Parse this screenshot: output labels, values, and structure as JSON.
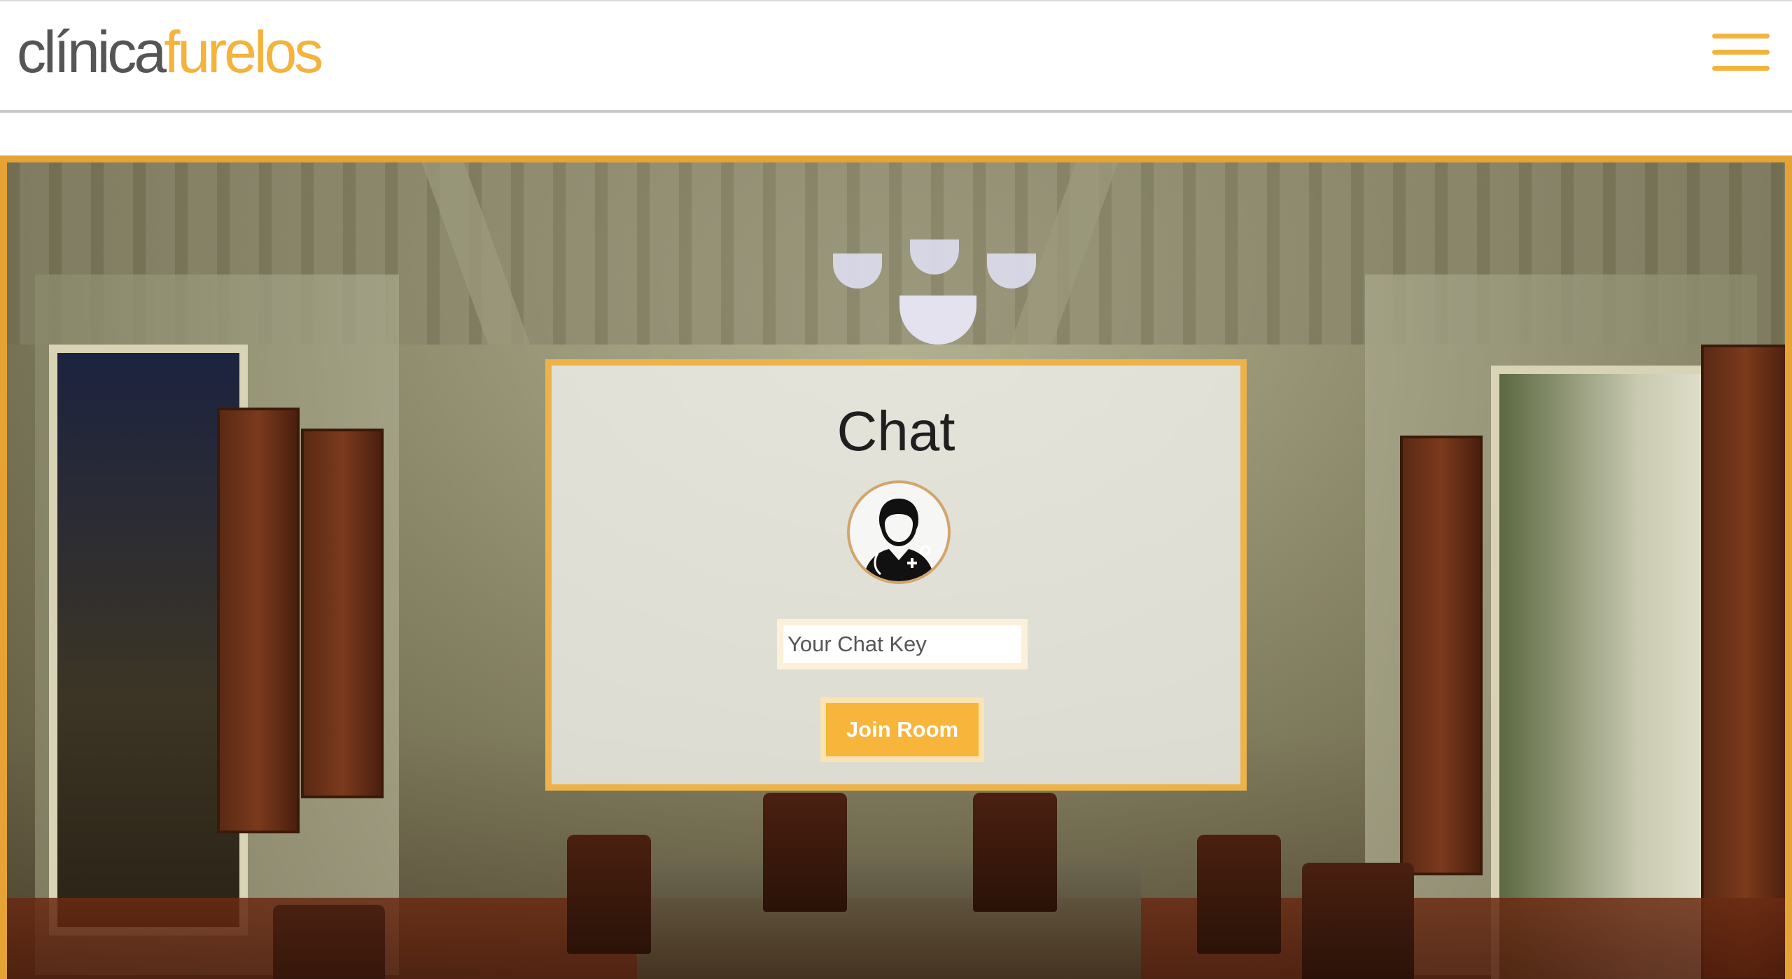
{
  "header": {
    "logo_part1": "clínica",
    "logo_part2": "furelos",
    "menu_icon": "hamburger-menu-icon",
    "accent_color": "#f3b33d"
  },
  "chat": {
    "title": "Chat",
    "avatar_icon": "doctor-avatar-icon",
    "key_input": {
      "placeholder": "Your Chat Key",
      "value": ""
    },
    "join_button_label": "Join Room",
    "border_color": "#edb34a"
  }
}
